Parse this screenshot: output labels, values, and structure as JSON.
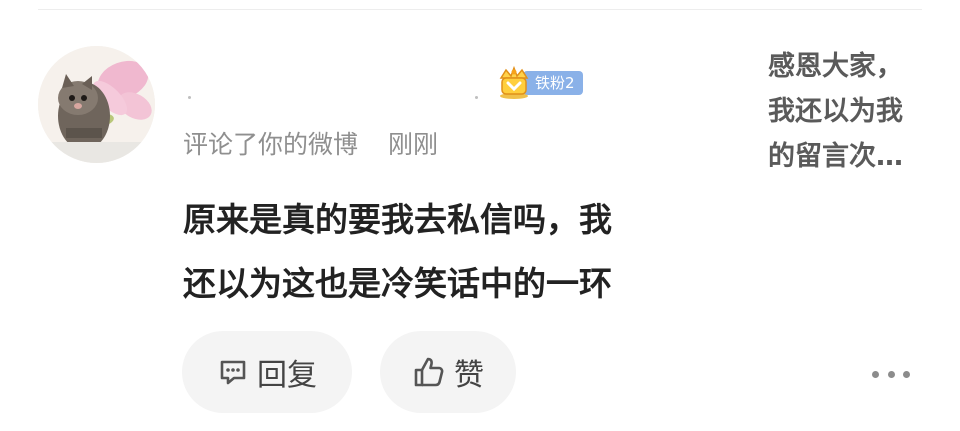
{
  "comment": {
    "fan_badge": {
      "label": "铁粉2",
      "icon": "fan-crown-icon"
    },
    "meta": {
      "action": "评论了你的微博",
      "time": "刚刚"
    },
    "lines": [
      "原来是真的要我去私信吗，我",
      "还以为这也是冷笑话中的一环"
    ]
  },
  "actions": {
    "reply_label": "回复",
    "like_label": "赞",
    "more_icon": "more-dots-icon"
  },
  "original_post": {
    "lines": [
      "感恩大家，",
      "我还以为我",
      "的留言次…"
    ]
  },
  "colors": {
    "badge_blue": "#8ab1e8",
    "button_bg": "#f4f4f4",
    "meta_gray": "#8f8f8f"
  }
}
